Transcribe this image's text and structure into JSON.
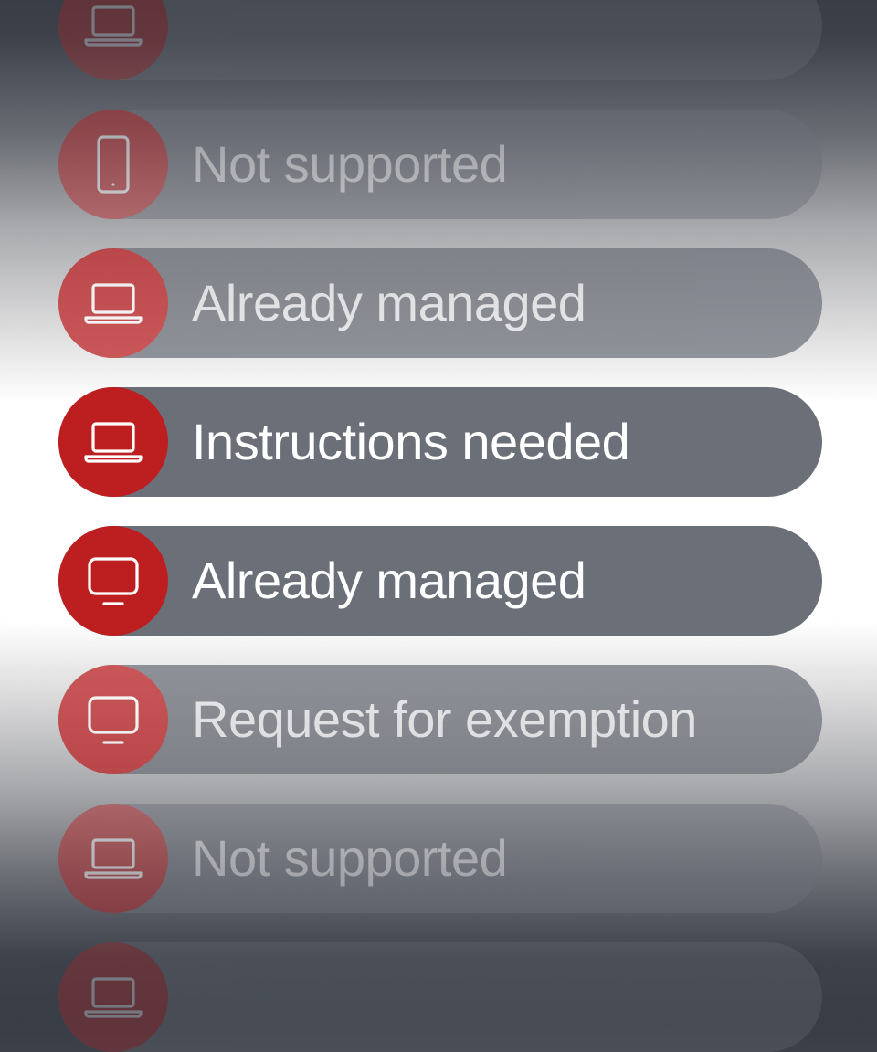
{
  "colors": {
    "pill": "#6b6f78",
    "accent": "#bd1f21",
    "text": "#ffffff"
  },
  "picker": {
    "items": [
      {
        "label": "",
        "icon": "laptop-icon"
      },
      {
        "label": "Not supported",
        "icon": "phone-icon"
      },
      {
        "label": "Already managed",
        "icon": "laptop-icon"
      },
      {
        "label": "Instructions needed",
        "icon": "laptop-icon"
      },
      {
        "label": "Already managed",
        "icon": "monitor-icon"
      },
      {
        "label": "Request for exemption",
        "icon": "monitor-icon"
      },
      {
        "label": "Not supported",
        "icon": "laptop-icon"
      },
      {
        "label": "",
        "icon": "laptop-icon"
      }
    ]
  }
}
